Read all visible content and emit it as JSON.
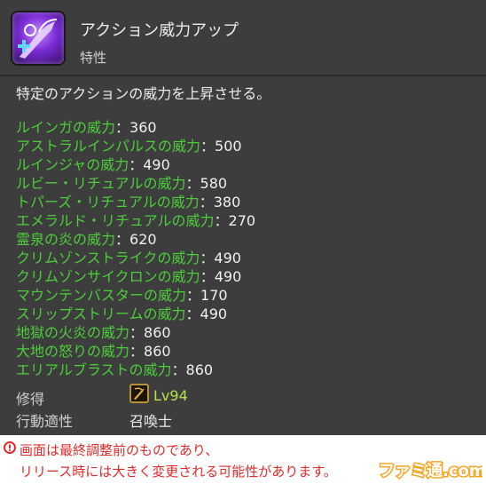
{
  "tooltip": {
    "title": "アクション威力アップ",
    "subtitle": "特性",
    "description": "特定のアクションの威力を上昇させる。",
    "separator": "：",
    "stats": [
      {
        "label": "ルインガの威力",
        "value": "360"
      },
      {
        "label": "アストラルインパルスの威力",
        "value": "500"
      },
      {
        "label": "ルインジャの威力",
        "value": "490"
      },
      {
        "label": "ルビー・リチュアルの威力",
        "value": "580"
      },
      {
        "label": "トパーズ・リチュアルの威力",
        "value": "380"
      },
      {
        "label": "エメラルド・リチュアルの威力",
        "value": "270"
      },
      {
        "label": "霊泉の炎の威力",
        "value": "620"
      },
      {
        "label": "クリムゾンストライクの威力",
        "value": "490"
      },
      {
        "label": "クリムゾンサイクロンの威力",
        "value": "490"
      },
      {
        "label": "マウンテンバスターの威力",
        "value": "170"
      },
      {
        "label": "スリップストリームの威力",
        "value": "490"
      },
      {
        "label": "地獄の火炎の威力",
        "value": "860"
      },
      {
        "label": "大地の怒りの威力",
        "value": "860"
      },
      {
        "label": "エリアルブラストの威力",
        "value": "860"
      }
    ],
    "acquired_label": "修得",
    "acquired_level": "Lv94",
    "job_label": "行動適性",
    "job_value": "召喚士"
  },
  "notice": {
    "mark": "!",
    "line1": "画面は最終調整前のものであり、",
    "line2": "リリース時には大きく変更される可能性があります。"
  },
  "watermark": {
    "text": "ファミ通.com"
  },
  "colors": {
    "panel_bg": "#3d3d3d",
    "stat_label": "#4ccd3a",
    "level_text": "#b7e04a",
    "notice_red": "#e02a2a",
    "watermark_orange": "#f5a623"
  },
  "icons": {
    "trait": "summoner-trait-icon",
    "job": "summoner-job-icon"
  }
}
